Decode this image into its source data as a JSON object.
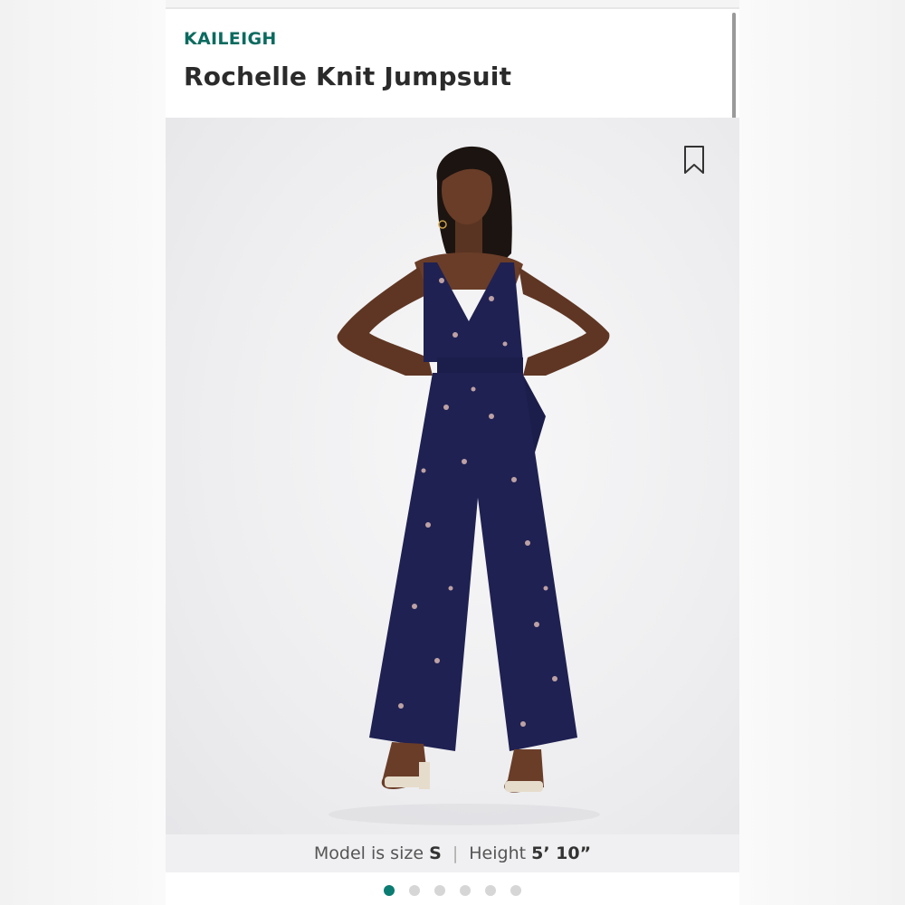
{
  "product": {
    "brand": "KAILEIGH",
    "title": "Rochelle Knit Jumpsuit"
  },
  "photo": {
    "description_icon": "bookmark-icon"
  },
  "caption": {
    "model_label": "Model is size",
    "model_size": "S",
    "separator": "|",
    "height_label": "Height",
    "height_value": "5’ 10”"
  },
  "carousel": {
    "total": 6,
    "active_index": 0
  },
  "colors": {
    "brand": "#0b6b5f",
    "active_dot": "#0b7c72",
    "jumpsuit": "#1f2152"
  }
}
